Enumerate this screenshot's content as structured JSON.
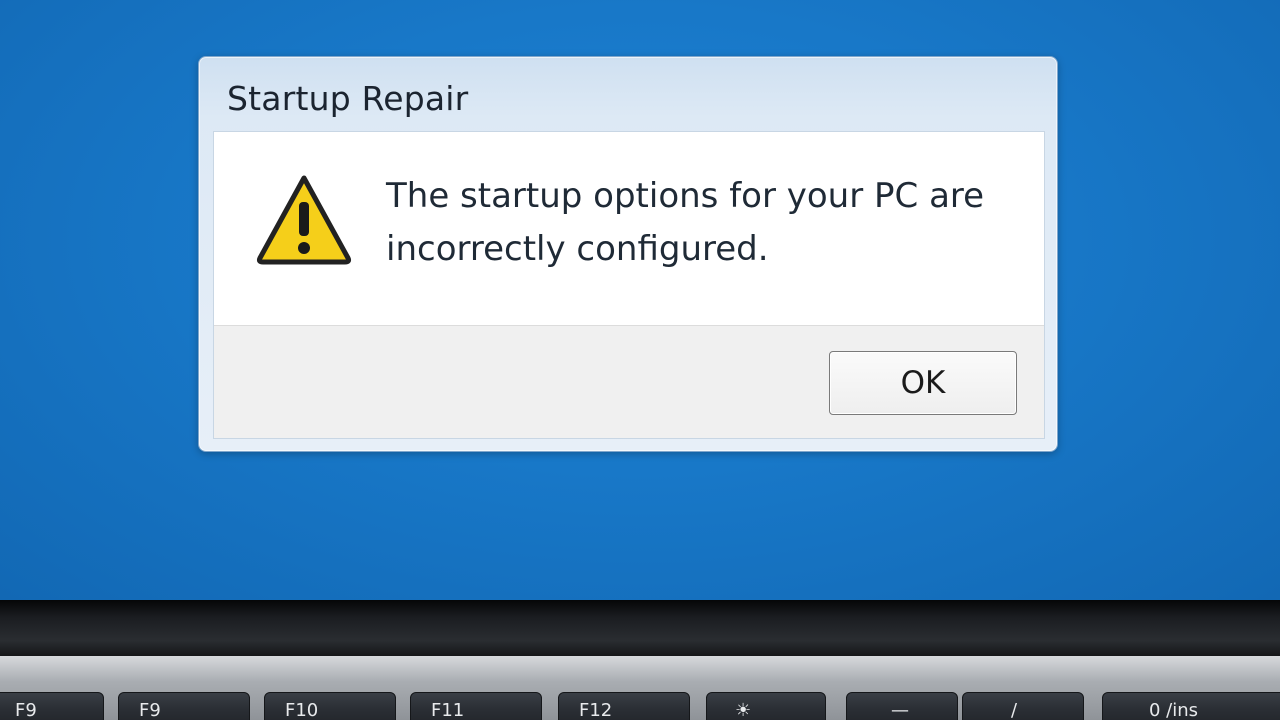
{
  "dialog": {
    "title": "Startup Repair",
    "message": "The startup options for your PC are incorrectly configured.",
    "icon": "warning-icon",
    "ok_label": "OK"
  },
  "keyboard": {
    "keys": [
      "F9",
      "F9",
      "F10",
      "F11",
      "F12",
      "☀",
      "—",
      "/",
      "0 /ins"
    ]
  },
  "colors": {
    "desktop": "#1878c8",
    "warning_fill": "#f5cf1a",
    "warning_outline": "#222222"
  }
}
